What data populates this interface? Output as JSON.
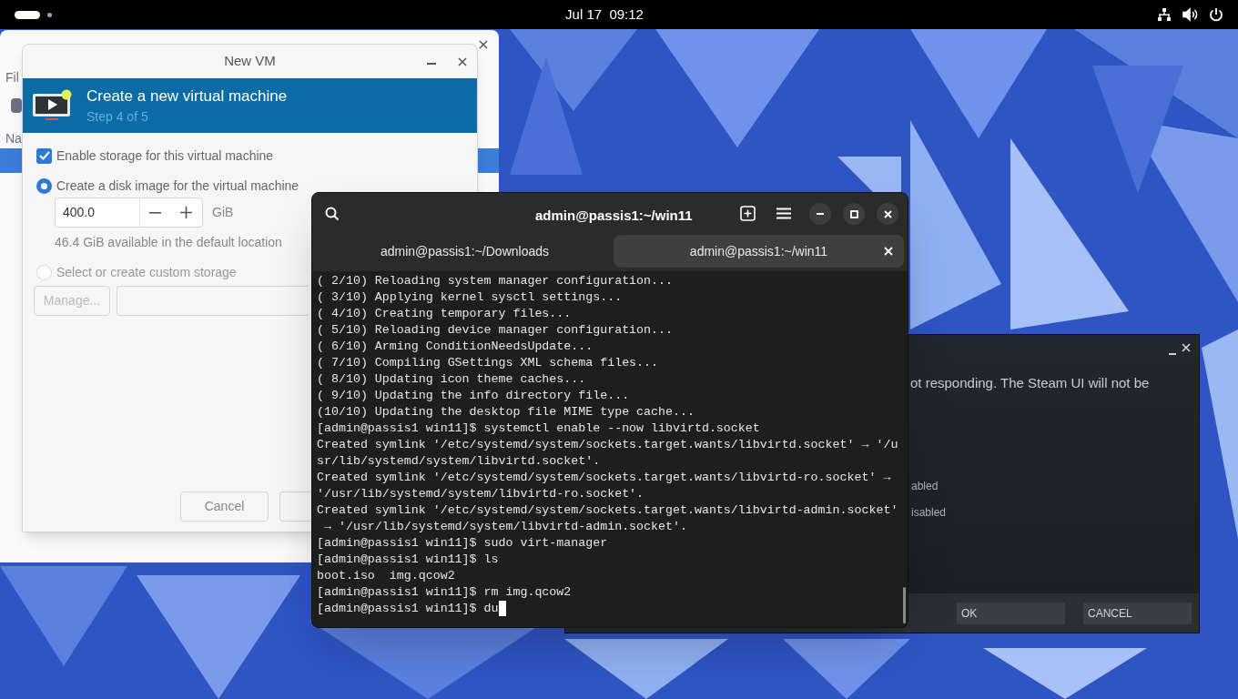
{
  "top_bar": {
    "clock": "Jul 17  09:12"
  },
  "vm_manager": {
    "menu_label": "Fil",
    "column_label": "Na"
  },
  "new_vm": {
    "title": "New VM",
    "header": {
      "title": "Create a new virtual machine",
      "step": "Step 4 of 5"
    },
    "enable_storage": {
      "label": "Enable storage for this virtual machine",
      "checked": true
    },
    "storage_options": [
      {
        "label": "Create a disk image for the virtual machine",
        "selected": true,
        "disabled": false
      },
      {
        "label": "Select or create custom storage",
        "selected": false,
        "disabled": true
      }
    ],
    "disk_size": {
      "value": "400.0",
      "unit": "GiB"
    },
    "available_note": "46.4 GiB available in the default location",
    "manage_button": {
      "label": "Manage...",
      "disabled": true
    },
    "buttons": [
      {
        "label": "Cancel"
      }
    ]
  },
  "terminal": {
    "title": "admin@passis1:~/win11",
    "tabs": [
      {
        "label": "admin@passis1:~/Downloads",
        "selected": false
      },
      {
        "label": "admin@passis1:~/win11",
        "selected": true
      }
    ],
    "lines": [
      "( 2/10) Reloading system manager configuration...",
      "( 3/10) Applying kernel sysctl settings...",
      "( 4/10) Creating temporary files...",
      "( 5/10) Reloading device manager configuration...",
      "( 6/10) Arming ConditionNeedsUpdate...",
      "( 7/10) Compiling GSettings XML schema files...",
      "( 8/10) Updating icon theme caches...",
      "( 9/10) Updating the info directory file...",
      "(10/10) Updating the desktop file MIME type cache...",
      "[admin@passis1 win11]$ systemctl enable --now libvirtd.socket",
      "Created symlink '/etc/systemd/system/sockets.target.wants/libvirtd.socket' → '/u",
      "sr/lib/systemd/system/libvirtd.socket'.",
      "Created symlink '/etc/systemd/system/sockets.target.wants/libvirtd-ro.socket' →",
      "'/usr/lib/systemd/system/libvirtd-ro.socket'.",
      "Created symlink '/etc/systemd/system/sockets.target.wants/libvirtd-admin.socket'",
      " → '/usr/lib/systemd/system/libvirtd-admin.socket'.",
      "[admin@passis1 win11]$ sudo virt-manager",
      "[admin@passis1 win11]$ ls",
      "boot.iso  img.qcow2",
      "[admin@passis1 win11]$ rm img.qcow2",
      "[admin@passis1 win11]$ du"
    ]
  },
  "steam_dialog": {
    "message": "ot responding. The Steam UI will not be",
    "options": [
      "abled",
      "isabled"
    ],
    "buttons": [
      "OK",
      "CANCEL"
    ]
  }
}
